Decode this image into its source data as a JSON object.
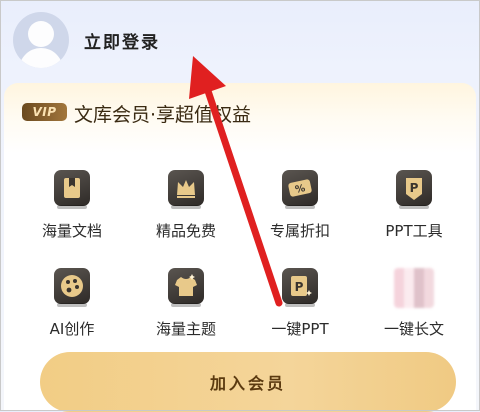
{
  "header": {
    "login_label": "立即登录"
  },
  "card": {
    "badge": "VIP",
    "title": "文库会员·享超值权益"
  },
  "benefits": [
    {
      "label": "海量文档",
      "icon": "bookmark-doc-icon"
    },
    {
      "label": "精品免费",
      "icon": "crown-icon"
    },
    {
      "label": "专属折扣",
      "icon": "discount-ticket-icon"
    },
    {
      "label": "PPT工具",
      "icon": "ppt-shield-icon"
    },
    {
      "label": "AI创作",
      "icon": "palette-icon"
    },
    {
      "label": "海量主题",
      "icon": "tshirt-icon"
    },
    {
      "label": "一键PPT",
      "icon": "ppt-sparkle-icon"
    },
    {
      "label": "一键长文",
      "icon": "long-text-icon"
    }
  ],
  "cta": {
    "label": "加入会员"
  },
  "colors": {
    "accent_gold": "#f2cd85",
    "arrow_red": "#e02020",
    "icon_dark": "#2e2a27"
  }
}
